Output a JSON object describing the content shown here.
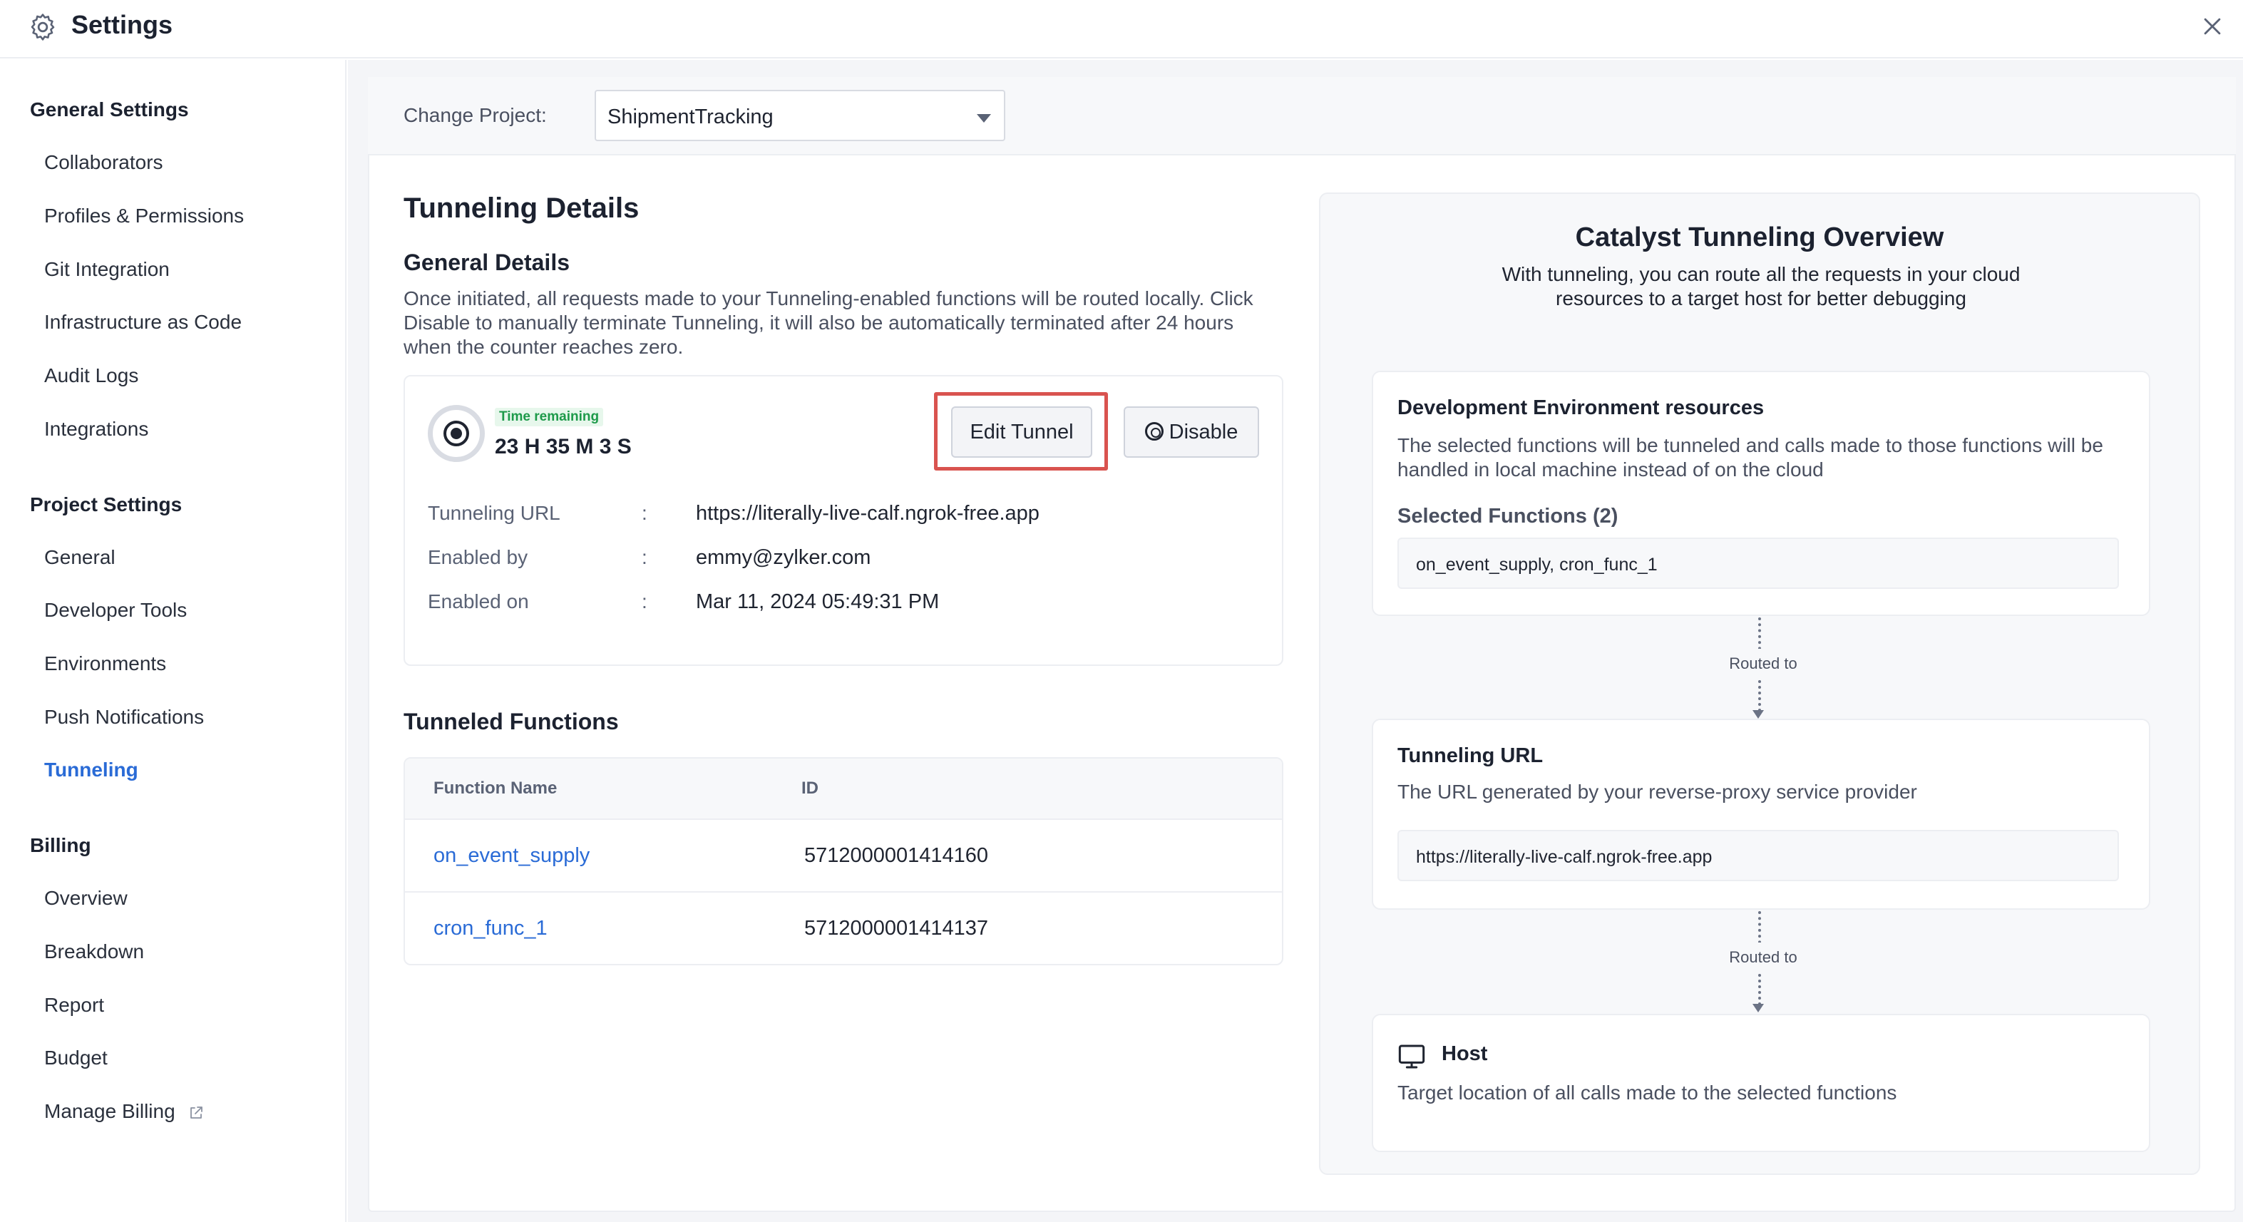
{
  "header": {
    "title": "Settings"
  },
  "sidebar": {
    "groups": [
      {
        "title": "General Settings",
        "items": [
          "Collaborators",
          "Profiles & Permissions",
          "Git Integration",
          "Infrastructure as Code",
          "Audit Logs",
          "Integrations"
        ]
      },
      {
        "title": "Project Settings",
        "items": [
          "General",
          "Developer Tools",
          "Environments",
          "Push Notifications",
          "Tunneling"
        ]
      },
      {
        "title": "Billing",
        "items": [
          "Overview",
          "Breakdown",
          "Report",
          "Budget",
          "Manage Billing"
        ]
      }
    ],
    "active_item": "Tunneling"
  },
  "project": {
    "label": "Change Project:",
    "selected": "ShipmentTracking"
  },
  "tunneling": {
    "title": "Tunneling Details",
    "general_title": "General Details",
    "description": "Once initiated, all requests made to your Tunneling-enabled functions will be routed locally. Click Disable to manually terminate Tunneling, it will also be automatically terminated after 24 hours when the counter reaches zero.",
    "time_badge": "Time remaining",
    "time_value": "23 H 35 M 3 S",
    "edit_label": "Edit Tunnel",
    "disable_label": "Disable",
    "details": [
      {
        "label": "Tunneling URL",
        "sep": ":",
        "value": "https://literally-live-calf.ngrok-free.app"
      },
      {
        "label": "Enabled by",
        "sep": ":",
        "value": "emmy@zylker.com"
      },
      {
        "label": "Enabled on",
        "sep": ":",
        "value": "Mar 11, 2024 05:49:31 PM"
      }
    ]
  },
  "functions": {
    "title": "Tunneled Functions",
    "columns": [
      "Function Name",
      "ID"
    ],
    "rows": [
      {
        "name": "on_event_supply",
        "id": "5712000001414160"
      },
      {
        "name": "cron_func_1",
        "id": "5712000001414137"
      }
    ]
  },
  "overview": {
    "title": "Catalyst Tunneling Overview",
    "subtitle": "With tunneling, you can route all the requests in your cloud resources to a target host for better debugging",
    "dev": {
      "title": "Development Environment resources",
      "desc": "The selected functions will be tunneled and calls made to those functions will be handled in local machine instead of on the cloud",
      "selected_label": "Selected Functions",
      "selected_count": "(2)",
      "selected_value": "on_event_supply, cron_func_1"
    },
    "routed_label": "Routed to",
    "url": {
      "title": "Tunneling URL",
      "desc": "The URL generated by your reverse-proxy service provider",
      "value": "https://literally-live-calf.ngrok-free.app"
    },
    "host": {
      "title": "Host",
      "desc": "Target location of all calls made to the selected functions"
    }
  },
  "colors": {
    "accent": "#2a6bd6",
    "highlight": "#d9534f",
    "badge": "#1e9a4a"
  }
}
